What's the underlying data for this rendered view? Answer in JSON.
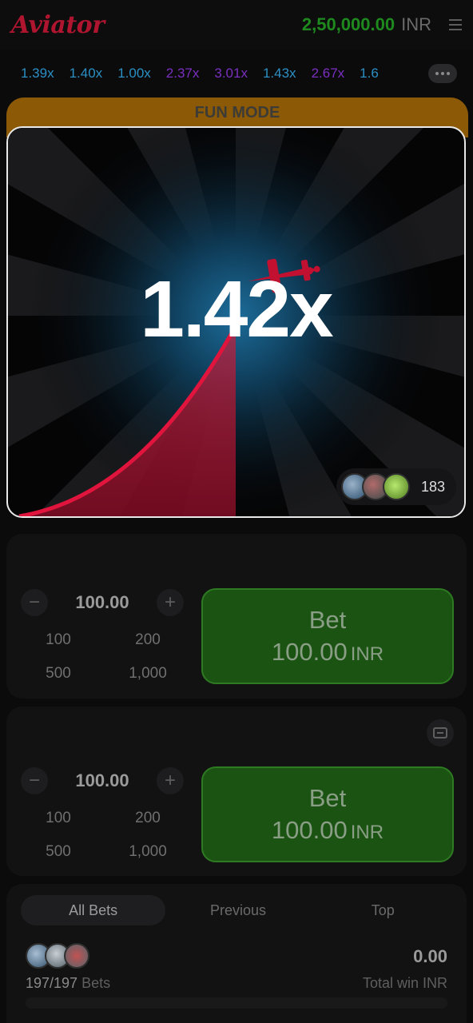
{
  "header": {
    "logo": "Aviator",
    "balance_amount": "2,50,000.00",
    "balance_currency": "INR",
    "menu_icon": "hamburger-menu-icon"
  },
  "history": {
    "multipliers": [
      {
        "value": "1.39x",
        "color": "#2b8fc4"
      },
      {
        "value": "1.40x",
        "color": "#2b8fc4"
      },
      {
        "value": "1.00x",
        "color": "#2b8fc4"
      },
      {
        "value": "2.37x",
        "color": "#7a2fc0"
      },
      {
        "value": "3.01x",
        "color": "#7a2fc0"
      },
      {
        "value": "1.43x",
        "color": "#2b8fc4"
      },
      {
        "value": "2.67x",
        "color": "#7a2fc0"
      },
      {
        "value": "1.6",
        "color": "#2b8fc4"
      }
    ],
    "more_icon": "more-dots-icon"
  },
  "game": {
    "mode_label": "FUN MODE",
    "multiplier": "1.42x",
    "players_count": "183",
    "curve_color": "#e0143c",
    "plane_icon": "airplane-icon"
  },
  "bet_panels": [
    {
      "stake": "100.00",
      "minus": "−",
      "plus": "+",
      "quick_amounts": [
        "100",
        "200",
        "500",
        "1,000"
      ],
      "bet_label": "Bet",
      "bet_amount": "100.00",
      "bet_currency": "INR"
    },
    {
      "stake": "100.00",
      "minus": "−",
      "plus": "+",
      "quick_amounts": [
        "100",
        "200",
        "500",
        "1,000"
      ],
      "bet_label": "Bet",
      "bet_amount": "100.00",
      "bet_currency": "INR"
    }
  ],
  "bets": {
    "tabs": [
      "All Bets",
      "Previous",
      "Top"
    ],
    "active_tab": "All Bets",
    "count": "197/197",
    "count_suffix": "Bets",
    "total_win": "0.00",
    "total_win_label": "Total win INR"
  }
}
